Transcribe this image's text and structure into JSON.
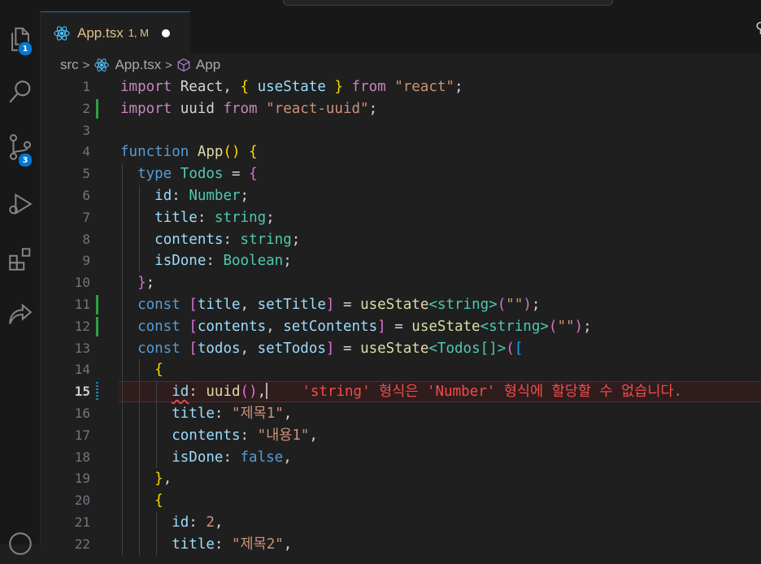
{
  "editor_tab": {
    "file_name": "App.tsx",
    "status": "1, M"
  },
  "breadcrumb": {
    "folder": "src",
    "file": "App.tsx",
    "symbol": "App"
  },
  "activity_bar": {
    "explorer_badge": "1",
    "source_control_badge": "3"
  },
  "colors": {
    "accent": "#0078d4",
    "error": "#f14c4c",
    "modified_gutter": "#2ea043"
  },
  "active_line": "15",
  "lines": [
    {
      "n": "1",
      "t": [
        [
          "import",
          "ctrl"
        ],
        [
          " React, ",
          ""
        ],
        [
          "{ ",
          "br1"
        ],
        [
          "useState",
          "var"
        ],
        [
          " } ",
          "br1"
        ],
        [
          "from",
          "ctrl"
        ],
        [
          " ",
          ""
        ],
        [
          "\"react\"",
          "str"
        ],
        [
          ";",
          ""
        ]
      ]
    },
    {
      "n": "2",
      "t": [
        [
          "import",
          "ctrl"
        ],
        [
          " uuid ",
          ""
        ],
        [
          "from",
          "ctrl"
        ],
        [
          " ",
          ""
        ],
        [
          "\"react-uuid\"",
          "str"
        ],
        [
          ";",
          ""
        ]
      ]
    },
    {
      "n": "3",
      "t": []
    },
    {
      "n": "4",
      "t": [
        [
          "function",
          "kw"
        ],
        [
          " ",
          ""
        ],
        [
          "App",
          "fn"
        ],
        [
          "() ",
          "br1"
        ],
        [
          "{",
          "br1"
        ]
      ]
    },
    {
      "n": "5",
      "t": [
        [
          "  ",
          ""
        ],
        [
          "type",
          "kw"
        ],
        [
          " ",
          ""
        ],
        [
          "Todos",
          "ty"
        ],
        [
          " = ",
          ""
        ],
        [
          "{",
          "br2"
        ]
      ]
    },
    {
      "n": "6",
      "t": [
        [
          "    ",
          ""
        ],
        [
          "id",
          "prop"
        ],
        [
          ": ",
          ""
        ],
        [
          "Number",
          "ty"
        ],
        [
          ";",
          ""
        ]
      ]
    },
    {
      "n": "7",
      "t": [
        [
          "    ",
          ""
        ],
        [
          "title",
          "prop"
        ],
        [
          ": ",
          ""
        ],
        [
          "string",
          "ty"
        ],
        [
          ";",
          ""
        ]
      ]
    },
    {
      "n": "8",
      "t": [
        [
          "    ",
          ""
        ],
        [
          "contents",
          "prop"
        ],
        [
          ": ",
          ""
        ],
        [
          "string",
          "ty"
        ],
        [
          ";",
          ""
        ]
      ]
    },
    {
      "n": "9",
      "t": [
        [
          "    ",
          ""
        ],
        [
          "isDone",
          "prop"
        ],
        [
          ": ",
          ""
        ],
        [
          "Boolean",
          "ty"
        ],
        [
          ";",
          ""
        ]
      ]
    },
    {
      "n": "10",
      "t": [
        [
          "  ",
          ""
        ],
        [
          "}",
          "br2"
        ],
        [
          ";",
          ""
        ]
      ]
    },
    {
      "n": "11",
      "t": [
        [
          "  ",
          ""
        ],
        [
          "const",
          "kw"
        ],
        [
          " ",
          ""
        ],
        [
          "[",
          "br2"
        ],
        [
          "title",
          "var"
        ],
        [
          ", ",
          ""
        ],
        [
          "setTitle",
          "var"
        ],
        [
          "]",
          "br2"
        ],
        [
          " = ",
          ""
        ],
        [
          "useState",
          "fn"
        ],
        [
          "<",
          "ty"
        ],
        [
          "string",
          "ty"
        ],
        [
          ">",
          "ty"
        ],
        [
          "(",
          "br2"
        ],
        [
          "\"\"",
          "str"
        ],
        [
          ")",
          "br2"
        ],
        [
          ";",
          ""
        ]
      ]
    },
    {
      "n": "12",
      "t": [
        [
          "  ",
          ""
        ],
        [
          "const",
          "kw"
        ],
        [
          " ",
          ""
        ],
        [
          "[",
          "br2"
        ],
        [
          "contents",
          "var"
        ],
        [
          ", ",
          ""
        ],
        [
          "setContents",
          "var"
        ],
        [
          "]",
          "br2"
        ],
        [
          " = ",
          ""
        ],
        [
          "useState",
          "fn"
        ],
        [
          "<",
          "ty"
        ],
        [
          "string",
          "ty"
        ],
        [
          ">",
          "ty"
        ],
        [
          "(",
          "br2"
        ],
        [
          "\"\"",
          "str"
        ],
        [
          ")",
          "br2"
        ],
        [
          ";",
          ""
        ]
      ]
    },
    {
      "n": "13",
      "t": [
        [
          "  ",
          ""
        ],
        [
          "const",
          "kw"
        ],
        [
          " ",
          ""
        ],
        [
          "[",
          "br2"
        ],
        [
          "todos",
          "var"
        ],
        [
          ", ",
          ""
        ],
        [
          "setTodos",
          "var"
        ],
        [
          "]",
          "br2"
        ],
        [
          " = ",
          ""
        ],
        [
          "useState",
          "fn"
        ],
        [
          "<",
          "ty"
        ],
        [
          "Todos",
          "ty"
        ],
        [
          "[]",
          "ty"
        ],
        [
          ">",
          "ty"
        ],
        [
          "(",
          "br2"
        ],
        [
          "[",
          "br3"
        ]
      ]
    },
    {
      "n": "14",
      "t": [
        [
          "    ",
          ""
        ],
        [
          "{",
          "br1"
        ]
      ]
    },
    {
      "n": "15",
      "t": [
        [
          "      ",
          ""
        ],
        [
          "id",
          "prop squig"
        ],
        [
          ": ",
          ""
        ],
        [
          "uuid",
          "fn"
        ],
        [
          "()",
          "br2"
        ],
        [
          ",",
          ""
        ]
      ]
    },
    {
      "n": "16",
      "t": [
        [
          "      ",
          ""
        ],
        [
          "title",
          "prop"
        ],
        [
          ": ",
          ""
        ],
        [
          "\"제목1\"",
          "str"
        ],
        [
          ",",
          ""
        ]
      ]
    },
    {
      "n": "17",
      "t": [
        [
          "      ",
          ""
        ],
        [
          "contents",
          "prop"
        ],
        [
          ": ",
          ""
        ],
        [
          "\"내용1\"",
          "str"
        ],
        [
          ",",
          ""
        ]
      ]
    },
    {
      "n": "18",
      "t": [
        [
          "      ",
          ""
        ],
        [
          "isDone",
          "prop"
        ],
        [
          ": ",
          ""
        ],
        [
          "false",
          "kw"
        ],
        [
          ",",
          ""
        ]
      ]
    },
    {
      "n": "19",
      "t": [
        [
          "    ",
          ""
        ],
        [
          "}",
          "br1"
        ],
        [
          ",",
          ""
        ]
      ]
    },
    {
      "n": "20",
      "t": [
        [
          "    ",
          ""
        ],
        [
          "{",
          "br1"
        ]
      ]
    },
    {
      "n": "21",
      "t": [
        [
          "      ",
          ""
        ],
        [
          "id",
          "prop"
        ],
        [
          ": ",
          ""
        ],
        [
          "2",
          "str"
        ],
        [
          ",",
          ""
        ]
      ]
    },
    {
      "n": "22",
      "t": [
        [
          "      ",
          ""
        ],
        [
          "title",
          "prop"
        ],
        [
          ": ",
          ""
        ],
        [
          "\"제목2\"",
          "str"
        ],
        [
          ",",
          ""
        ]
      ]
    }
  ],
  "inline_error": {
    "part1": "'string'",
    "part2": " 형식은 ",
    "part3": "'Number'",
    "part4": " 형식에 할당할 수 없습니다."
  }
}
